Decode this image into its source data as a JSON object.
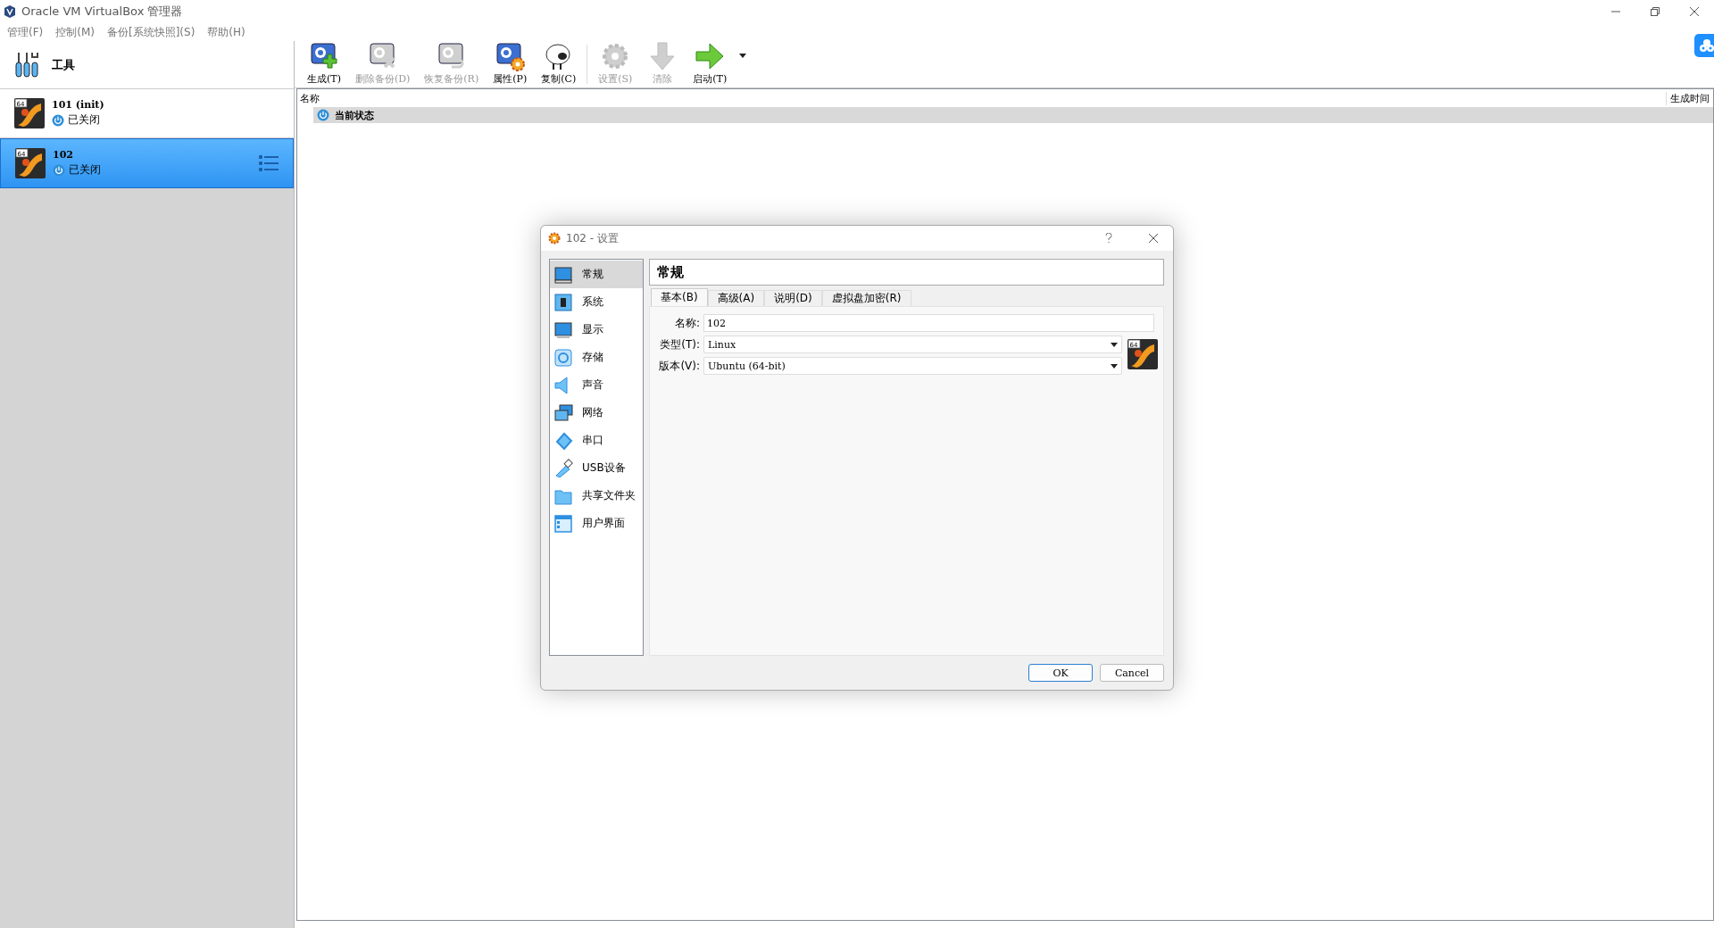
{
  "window": {
    "title": "Oracle VM VirtualBox 管理器"
  },
  "menu": [
    "管理(F)",
    "控制(M)",
    "备份[系统快照](S)",
    "帮助(H)"
  ],
  "tools": {
    "label": "工具"
  },
  "vms": [
    {
      "name": "101 (init)",
      "state": "已关闭",
      "selected": false,
      "badge": "64"
    },
    {
      "name": "102",
      "state": "已关闭",
      "selected": true,
      "badge": "64"
    }
  ],
  "toolbar": [
    {
      "label": "生成(T)",
      "disabled": false
    },
    {
      "label": "删除备份(D)",
      "disabled": true
    },
    {
      "label": "恢复备份(R)",
      "disabled": true
    },
    {
      "label": "属性(P)",
      "disabled": false
    },
    {
      "label": "复制(C)",
      "disabled": false
    },
    {
      "label": "设置(S)",
      "disabled": true
    },
    {
      "label": "清除",
      "disabled": true
    },
    {
      "label": "启动(T)",
      "disabled": false
    }
  ],
  "snapshots": {
    "columns": [
      "名称",
      "生成时间"
    ],
    "rows": [
      {
        "name": "当前状态",
        "selected": true
      }
    ]
  },
  "dialog": {
    "title": "102 - 设置",
    "sidebar": [
      {
        "label": "常规",
        "selected": true
      },
      {
        "label": "系统",
        "selected": false
      },
      {
        "label": "显示",
        "selected": false
      },
      {
        "label": "存储",
        "selected": false
      },
      {
        "label": "声音",
        "selected": false
      },
      {
        "label": "网络",
        "selected": false
      },
      {
        "label": "串口",
        "selected": false
      },
      {
        "label": "USB设备",
        "selected": false
      },
      {
        "label": "共享文件夹",
        "selected": false
      },
      {
        "label": "用户界面",
        "selected": false
      }
    ],
    "header": "常规",
    "os_badge": "64",
    "tabs": [
      {
        "label": "基本(B)",
        "selected": true
      },
      {
        "label": "高级(A)",
        "selected": false
      },
      {
        "label": "说明(D)",
        "selected": false
      },
      {
        "label": "虚拟盘加密(R)",
        "selected": false
      }
    ],
    "fields": [
      {
        "kind": "text",
        "label": "名称:",
        "value": "102"
      },
      {
        "kind": "select",
        "label": "类型(T):",
        "value": "Linux"
      },
      {
        "kind": "select",
        "label": "版本(V):",
        "value": "Ubuntu (64-bit)"
      }
    ],
    "buttons": [
      "OK",
      "Cancel"
    ]
  }
}
